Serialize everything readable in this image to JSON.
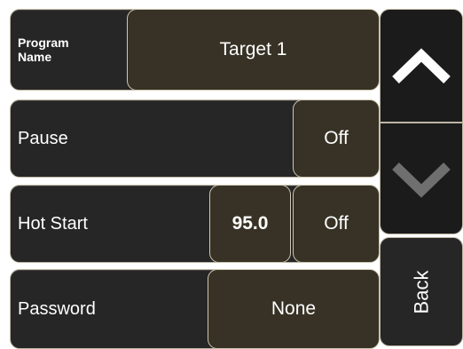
{
  "program_name": {
    "label_line1": "Program",
    "label_line2": "Name",
    "value": "Target 1"
  },
  "pause": {
    "label": "Pause",
    "state": "Off"
  },
  "hot_start": {
    "label": "Hot Start",
    "temperature": "95.0",
    "state": "Off"
  },
  "password": {
    "label": "Password",
    "value": "None"
  },
  "nav": {
    "scroll_up": "chevron-up-icon",
    "scroll_down": "chevron-down-icon",
    "back_label": "Back"
  },
  "colors": {
    "row_bg": "#262626",
    "value_bg": "#373225",
    "border": "#bdb6a3",
    "text": "#ffffff",
    "arrow_active": "#ffffff",
    "arrow_disabled": "#6f6f6f"
  }
}
